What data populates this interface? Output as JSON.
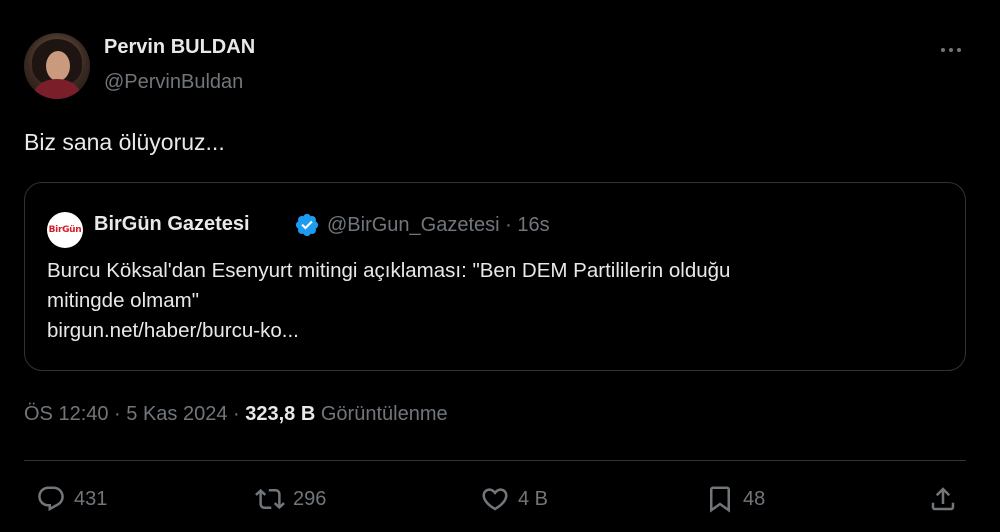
{
  "author": {
    "display_name": "Pervin BULDAN",
    "handle": "@PervinBuldan",
    "avatar_icon": "profile-photo"
  },
  "tweet": {
    "text": "Biz sana ölüyoruz..."
  },
  "quote": {
    "avatar_logo_text": "BirGün",
    "name": "BirGün Gazetesi",
    "verified_icon": "verified-badge-icon",
    "verified_color": "#1d9bf0",
    "handle_time": "@BirGun_Gazetesi · 16s",
    "line1": "Burcu Köksal'dan Esenyurt mitingi açıklaması: \"Ben DEM Partililerin olduğu",
    "line2": "mitingde olmam\"",
    "link": "birgun.net/haber/burcu-ko..."
  },
  "meta": {
    "time_date": "ÖS 12:40 · 5 Kas 2024 · ",
    "views_count": "323,8 B",
    "views_label": " Görüntülenme"
  },
  "actions": {
    "replies": "431",
    "reposts": "296",
    "likes": "4 B",
    "bookmarks": "48"
  },
  "colors": {
    "background": "#000000",
    "text": "#e7e9ea",
    "secondary": "#71767b",
    "border": "#2f3336",
    "accent": "#1d9bf0"
  }
}
